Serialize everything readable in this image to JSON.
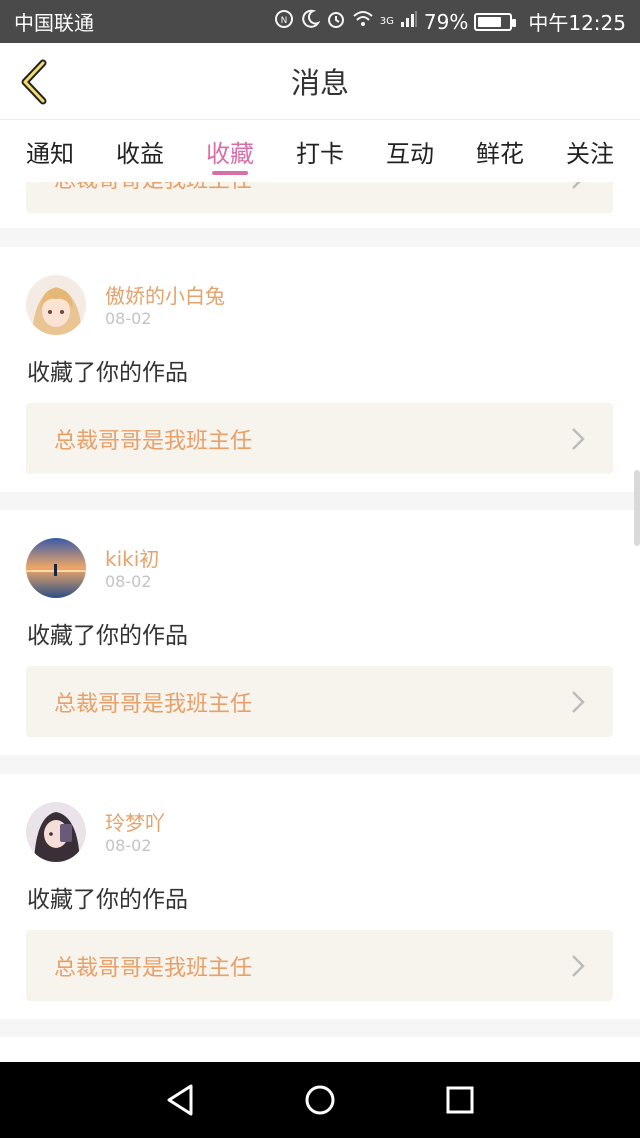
{
  "status_bar": {
    "carrier": "中国联通",
    "network": "3G",
    "battery": "79%",
    "battery_level": 0.79,
    "time": "中午12:25",
    "icons": [
      "nfc-icon",
      "moon-icon",
      "alarm-icon",
      "wifi-icon",
      "signal-icon",
      "battery-icon"
    ]
  },
  "header": {
    "title": "消息"
  },
  "tabs": [
    {
      "label": "通知"
    },
    {
      "label": "收益"
    },
    {
      "label": "收藏",
      "active": true
    },
    {
      "label": "打卡"
    },
    {
      "label": "互动"
    },
    {
      "label": "鲜花"
    },
    {
      "label": "关注"
    }
  ],
  "partial_card": {
    "work_title": "总裁哥哥是我班主任"
  },
  "messages": [
    {
      "username": "傲娇的小白兔",
      "date": "08-02",
      "action": "收藏了你的作品",
      "work_title": "总裁哥哥是我班主任"
    },
    {
      "username": "kiki初",
      "date": "08-02",
      "action": "收藏了你的作品",
      "work_title": "总裁哥哥是我班主任"
    },
    {
      "username": "玲梦吖",
      "date": "08-02",
      "action": "收藏了你的作品",
      "work_title": "总裁哥哥是我班主任"
    }
  ],
  "colors": {
    "accent": "#d86fa7",
    "username": "#e6a26b",
    "link": "#e7a06a",
    "ref_bg": "#f6f4ec"
  }
}
